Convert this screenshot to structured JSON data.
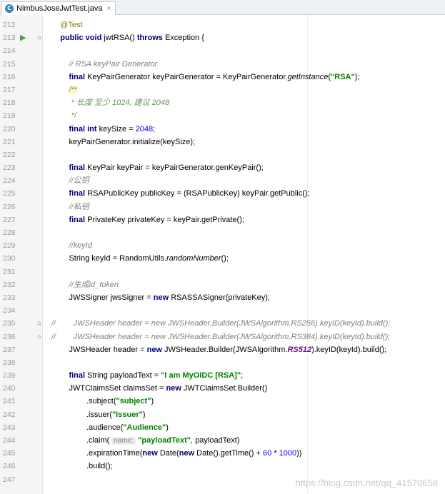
{
  "tab": {
    "icon": "java-class-icon",
    "icon_glyph": "C",
    "label": "NimbusJoseJwtTest.java",
    "close": "×"
  },
  "line_numbers": [
    "212",
    "213",
    "214",
    "215",
    "216",
    "217",
    "218",
    "219",
    "220",
    "221",
    "222",
    "223",
    "224",
    "225",
    "226",
    "227",
    "228",
    "229",
    "230",
    "231",
    "232",
    "233",
    "234",
    "235",
    "236",
    "237",
    "238",
    "239",
    "240",
    "241",
    "242",
    "243",
    "244",
    "245",
    "246",
    "247"
  ],
  "gutter_icons": {
    "run": "run-test-icon",
    "fold": "fold-marker-icon"
  },
  "code": [
    [
      {
        "t": "    "
      },
      {
        "c": "ann",
        "t": "@Test"
      }
    ],
    [
      {
        "t": "    "
      },
      {
        "c": "kw",
        "t": "public void "
      },
      {
        "t": "jwtRSA() "
      },
      {
        "c": "kw",
        "t": "throws "
      },
      {
        "t": "Exception {"
      }
    ],
    [],
    [
      {
        "t": "        "
      },
      {
        "c": "cmt",
        "t": "// RSA keyPair Generator"
      }
    ],
    [
      {
        "t": "        "
      },
      {
        "c": "kw",
        "t": "final "
      },
      {
        "t": "KeyPairGenerator keyPairGenerator = KeyPairGenerator."
      },
      {
        "c": "it",
        "t": "getInstance"
      },
      {
        "t": "("
      },
      {
        "c": "str",
        "t": "\"RSA\""
      },
      {
        "t": ");"
      }
    ],
    [
      {
        "t": "        "
      },
      {
        "c": "doc doc-hl",
        "t": "/**"
      }
    ],
    [
      {
        "t": "         "
      },
      {
        "c": "doc",
        "t": "* 长度 至少 1024, 建议 2048"
      }
    ],
    [
      {
        "t": "         "
      },
      {
        "c": "doc",
        "t": "*/"
      }
    ],
    [
      {
        "t": "        "
      },
      {
        "c": "kw",
        "t": "final int "
      },
      {
        "t": "keySize = "
      },
      {
        "c": "num",
        "t": "2048"
      },
      {
        "t": ";"
      }
    ],
    [
      {
        "t": "        "
      },
      {
        "t": "keyPairGenerator.initialize(keySize);"
      }
    ],
    [],
    [
      {
        "t": "        "
      },
      {
        "c": "kw",
        "t": "final "
      },
      {
        "t": "KeyPair keyPair = keyPairGenerator.genKeyPair();"
      }
    ],
    [
      {
        "t": "        "
      },
      {
        "c": "cmt",
        "t": "//公钥"
      }
    ],
    [
      {
        "t": "        "
      },
      {
        "c": "kw",
        "t": "final "
      },
      {
        "t": "RSAPublicKey publicKey = (RSAPublicKey) keyPair.getPublic();"
      }
    ],
    [
      {
        "t": "        "
      },
      {
        "c": "cmt",
        "t": "//私钥"
      }
    ],
    [
      {
        "t": "        "
      },
      {
        "c": "kw",
        "t": "final "
      },
      {
        "t": "PrivateKey privateKey = keyPair.getPrivate();"
      }
    ],
    [],
    [
      {
        "t": "        "
      },
      {
        "c": "cmt",
        "t": "//keyId"
      }
    ],
    [
      {
        "t": "        "
      },
      {
        "t": "String keyId = RandomUtils."
      },
      {
        "c": "it",
        "t": "randomNumber"
      },
      {
        "t": "();"
      }
    ],
    [],
    [
      {
        "t": "        "
      },
      {
        "c": "cmt",
        "t": "//生成id_token"
      }
    ],
    [
      {
        "t": "        "
      },
      {
        "t": "JWSSigner jwsSigner = "
      },
      {
        "c": "kw",
        "t": "new "
      },
      {
        "t": "RSASSASigner(privateKey);"
      }
    ],
    [],
    [
      {
        "c": "cmt",
        "t": "//        JWSHeader header = new JWSHeader.Builder(JWSAlgorithm.RS256).keyID(keyId).build();"
      }
    ],
    [
      {
        "c": "cmt",
        "t": "//        JWSHeader header = new JWSHeader.Builder(JWSAlgorithm.RS384).keyID(keyId).build();"
      }
    ],
    [
      {
        "t": "        "
      },
      {
        "t": "JWSHeader header = "
      },
      {
        "c": "kw",
        "t": "new "
      },
      {
        "t": "JWSHeader.Builder(JWSAlgorithm."
      },
      {
        "c": "field",
        "t": "RS512"
      },
      {
        "t": ").keyID(keyId).build();"
      }
    ],
    [],
    [
      {
        "t": "        "
      },
      {
        "c": "kw",
        "t": "final "
      },
      {
        "t": "String payloadText = "
      },
      {
        "c": "str",
        "t": "\"I am MyOIDC [RSA]\""
      },
      {
        "t": ";"
      }
    ],
    [
      {
        "t": "        "
      },
      {
        "t": "JWTClaimsSet claimsSet = "
      },
      {
        "c": "kw",
        "t": "new "
      },
      {
        "t": "JWTClaimsSet.Builder()"
      }
    ],
    [
      {
        "t": "                "
      },
      {
        "t": ".subject("
      },
      {
        "c": "str",
        "t": "\"subject\""
      },
      {
        "t": ")"
      }
    ],
    [
      {
        "t": "                "
      },
      {
        "t": ".issuer("
      },
      {
        "c": "str",
        "t": "\"Issuer\""
      },
      {
        "t": ")"
      }
    ],
    [
      {
        "t": "                "
      },
      {
        "t": ".audience("
      },
      {
        "c": "str",
        "t": "\"Audience\""
      },
      {
        "t": ")"
      }
    ],
    [
      {
        "t": "                "
      },
      {
        "t": ".claim( "
      },
      {
        "c": "hint",
        "t": "name:"
      },
      {
        "t": " "
      },
      {
        "c": "str",
        "t": "\"payloadText\""
      },
      {
        "t": ", payloadText)"
      }
    ],
    [
      {
        "t": "                "
      },
      {
        "t": ".expirationTime("
      },
      {
        "c": "kw",
        "t": "new "
      },
      {
        "t": "Date("
      },
      {
        "c": "kw",
        "t": "new "
      },
      {
        "t": "Date().getTime() + "
      },
      {
        "c": "num",
        "t": "60"
      },
      {
        "t": " * "
      },
      {
        "c": "num",
        "t": "1000"
      },
      {
        "t": "))"
      }
    ],
    [
      {
        "t": "                "
      },
      {
        "t": ".build();"
      }
    ],
    []
  ],
  "watermark": "https://blog.csdn.net/qq_41570658"
}
